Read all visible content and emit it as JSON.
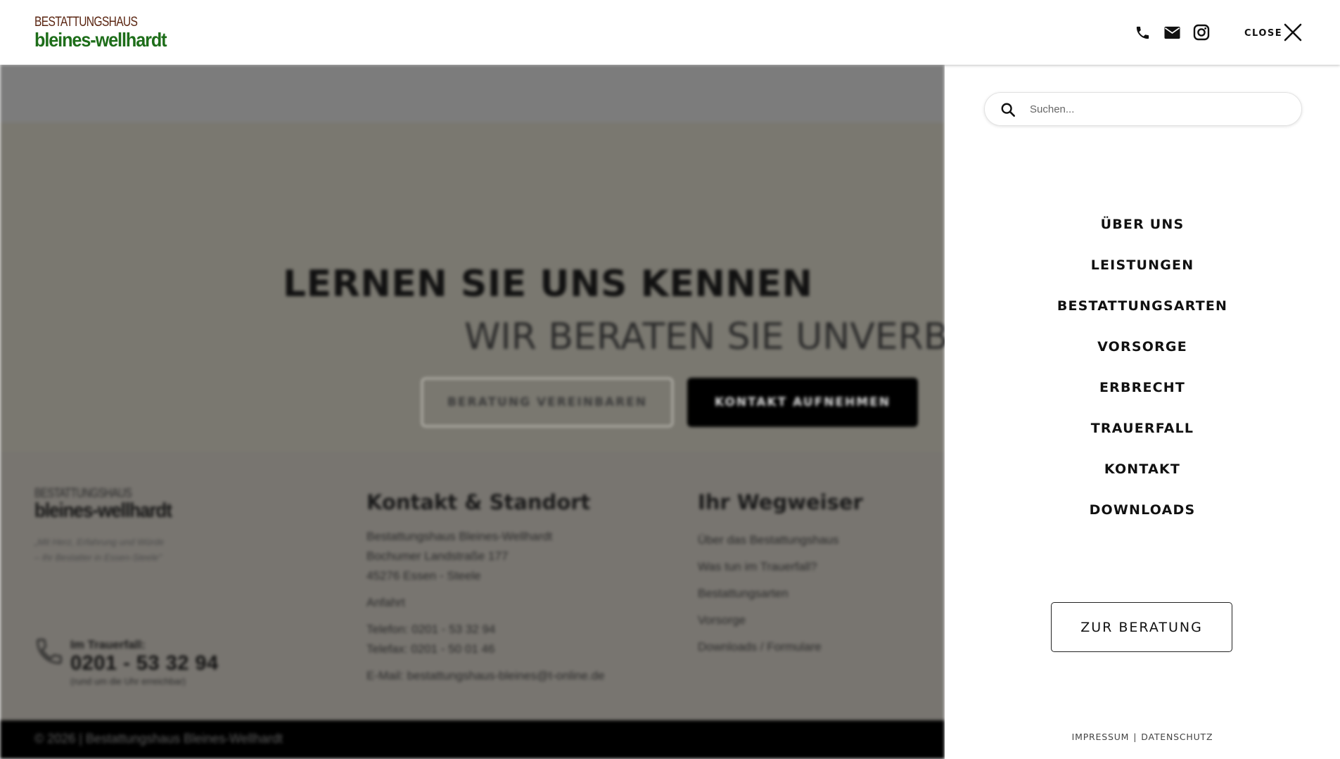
{
  "header": {
    "logo_top": "BESTATTUNGSHAUS",
    "logo_main": "bleines-wellhardt",
    "icons": [
      "phone-icon",
      "envelope-icon",
      "instagram-icon"
    ],
    "close_label": "CLOSE"
  },
  "background": {
    "hero": {
      "title": "LERNEN SIE UNS KENNEN",
      "subtitle": "WIR BERATEN SIE UNVERBIN",
      "btn_outline": "BERATUNG VEREINBAREN",
      "btn_solid": "KONTAKT AUFNEHMEN"
    },
    "footer": {
      "logo_top": "BESTATTUNGSHAUS",
      "logo_main": "bleines-wellhardt",
      "quote": "„Mit Herz, Erfahrung und Würde\n – Ihr Bestatter in Essen-Steele\"",
      "phone_label": "Im Trauerfall:",
      "phone_number": "0201 - 53 32 94",
      "phone_note": "(rund um die Uhr erreichbar)",
      "contact": {
        "heading": "Kontakt & Standort",
        "address": [
          "Bestattungshaus Bleines-Wellhardt",
          "Bochumer Landstraße 177",
          "45276 Essen - Steele"
        ],
        "directions": "Anfahrt",
        "phone": "Telefon: 0201 - 53 32 94",
        "fax": "Telefax: 0201 - 50 01 46",
        "email": "E-Mail: bestattungshaus-bleines@t-online.de"
      },
      "guide": {
        "heading": "Ihr Wegweiser",
        "links": [
          "Über das Bestattungshaus",
          "Was tun im Trauerfall?",
          "Bestattungsarten",
          "Vorsorge",
          "Downloads / Formulare"
        ]
      },
      "copyright": "© 2026  |  Bestattungshaus Bleines-Wellhardt"
    }
  },
  "panel": {
    "search_placeholder": "Suchen...",
    "menu": [
      "ÜBER UNS",
      "LEISTUNGEN",
      "BESTATTUNGSARTEN",
      "VORSORGE",
      "ERBRECHT",
      "TRAUERFALL",
      "KONTAKT",
      "DOWNLOADS"
    ],
    "cta": "ZUR BERATUNG",
    "legal": {
      "impressum": "IMPRESSUM",
      "separator": "|",
      "datenschutz": "DATENSCHUTZ"
    }
  }
}
